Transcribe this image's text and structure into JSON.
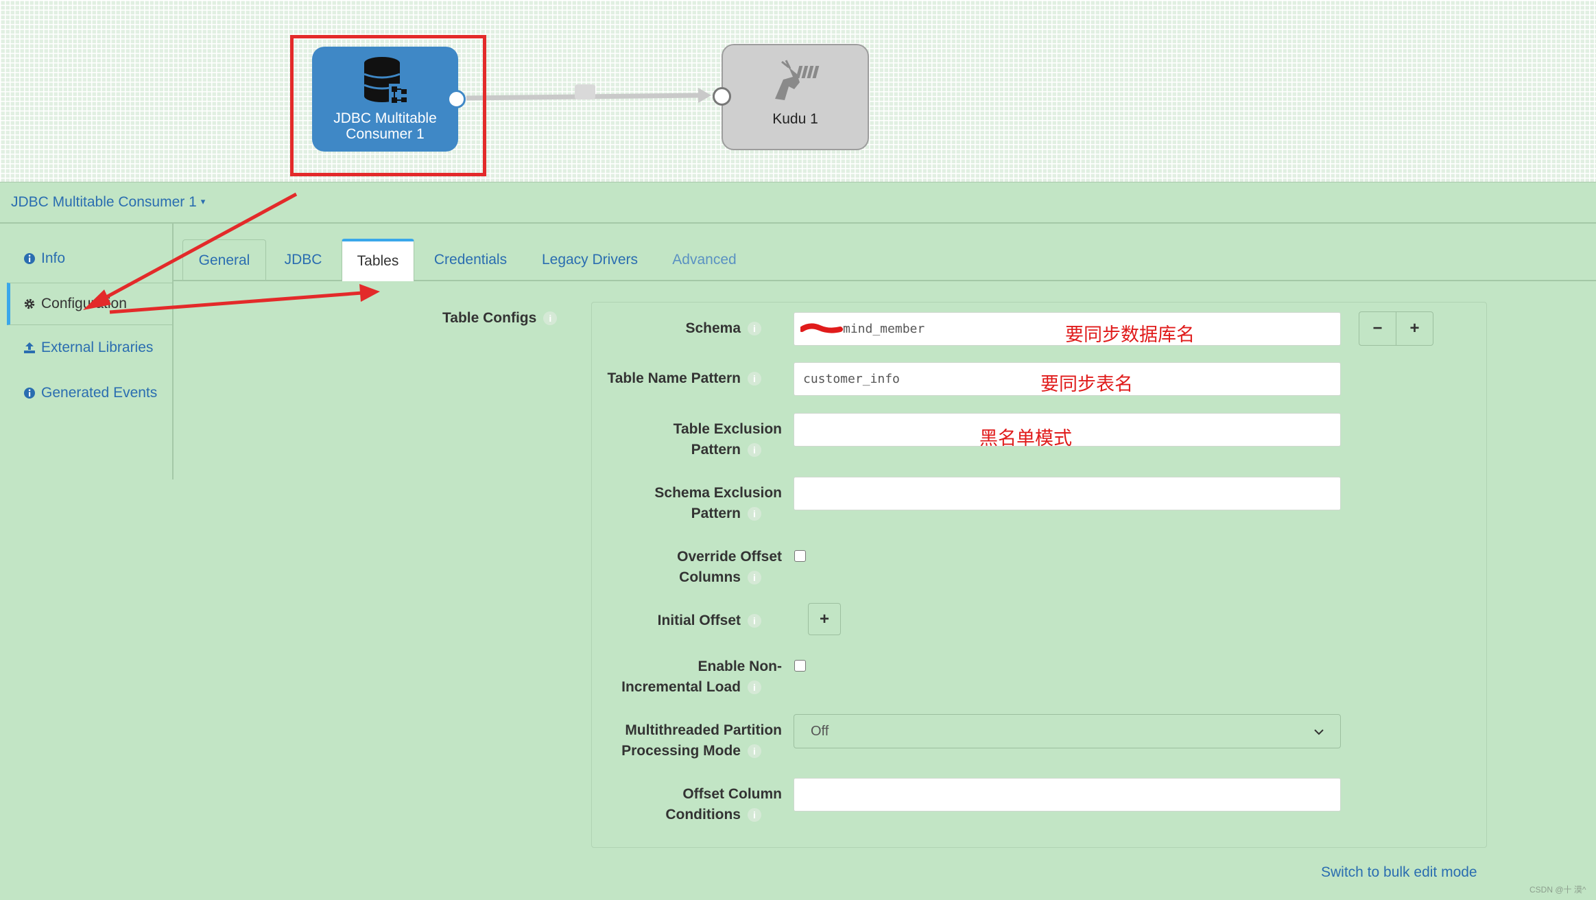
{
  "canvas": {
    "source_stage": {
      "label_line1": "JDBC Multitable",
      "label_line2": "Consumer 1",
      "icon": "database-multitable-icon"
    },
    "target_stage": {
      "label": "Kudu 1",
      "icon": "kudu-antelope-icon"
    }
  },
  "header": {
    "stage_title": "JDBC Multitable Consumer 1",
    "caret": "▾"
  },
  "sidenav": {
    "items": [
      {
        "label": "Info",
        "icon": "info-circle-icon"
      },
      {
        "label": "Configuration",
        "icon": "gear-icon"
      },
      {
        "label": "External Libraries",
        "icon": "upload-icon"
      },
      {
        "label": "Generated Events",
        "icon": "info-circle-icon"
      }
    ]
  },
  "tabs": [
    "General",
    "JDBC",
    "Tables",
    "Credentials",
    "Legacy Drivers",
    "Advanced"
  ],
  "form": {
    "section_label": "Table Configs",
    "fields": {
      "schema": {
        "label": "Schema",
        "value": "mind_member"
      },
      "table_name_pattern": {
        "label": "Table Name Pattern",
        "value": "customer_info"
      },
      "table_exclusion_pattern": {
        "label_line1": "Table Exclusion",
        "label_line2": "Pattern",
        "value": ""
      },
      "schema_exclusion_pattern": {
        "label_line1": "Schema Exclusion",
        "label_line2": "Pattern",
        "value": ""
      },
      "override_offset_columns": {
        "label_line1": "Override Offset",
        "label_line2": "Columns"
      },
      "initial_offset": {
        "label": "Initial Offset"
      },
      "enable_non_incremental": {
        "label_line1": "Enable Non-",
        "label_line2": "Incremental Load"
      },
      "multithreaded_partition": {
        "label_line1": "Multithreaded Partition",
        "label_line2": "Processing Mode",
        "selected": "Off"
      },
      "offset_column_conditions": {
        "label_line1": "Offset Column",
        "label_line2": "Conditions",
        "value": ""
      }
    },
    "buttons": {
      "minus": "−",
      "plus": "+"
    },
    "bulk_edit_link": "Switch to bulk edit mode"
  },
  "annotations": {
    "schema_note": "要同步数据库名",
    "table_note": "要同步表名",
    "exclusion_note": "黑名单模式"
  },
  "watermark": "CSDN @十 漠^",
  "colors": {
    "panel_bg": "#c2e5c5",
    "accent_blue": "#3f88c6",
    "link_blue": "#2a6db0",
    "annotation_red": "#e01b1b"
  }
}
